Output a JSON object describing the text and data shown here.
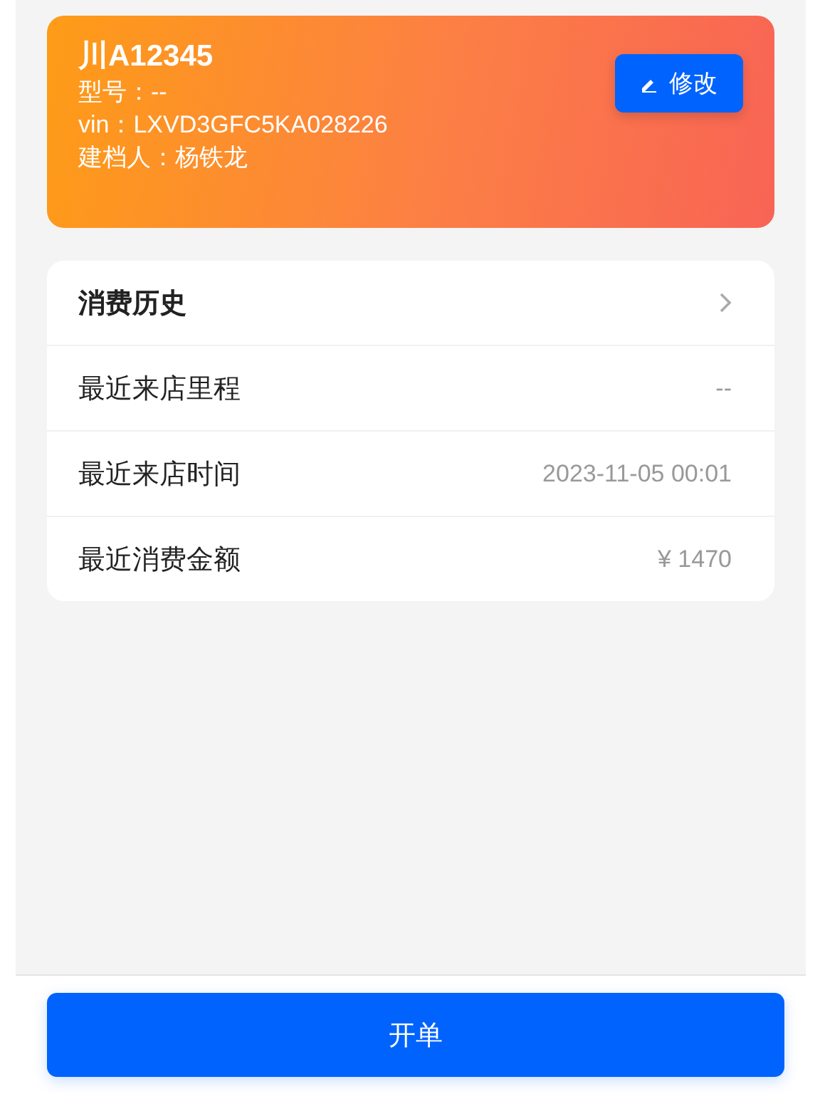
{
  "vehicle": {
    "plate": "川A12345",
    "lines": [
      "型号：--",
      "vin：LXVD3GFC5KA028226",
      "建档人：杨铁龙"
    ],
    "edit_button": "修改"
  },
  "info": [
    {
      "kind": "link",
      "label": "消费历史"
    },
    {
      "kind": "value",
      "label": "最近来店里程",
      "value": "--"
    },
    {
      "kind": "value",
      "label": "最近来店时间",
      "value": "2023-11-05 00:01"
    },
    {
      "kind": "value",
      "label": "最近消费金额",
      "value": "¥ 1470"
    }
  ],
  "footer_button": "开单"
}
